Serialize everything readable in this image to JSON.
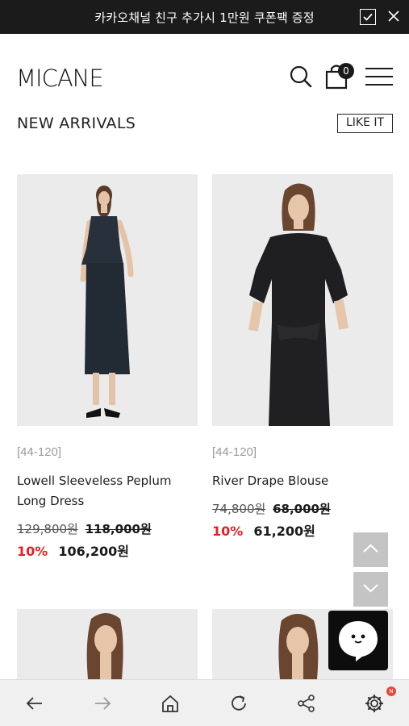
{
  "promo": {
    "text": "카카오채널 친구 추가시 1만원 쿠폰팩 증정"
  },
  "header": {
    "logo_text": "MICANE",
    "cart_count": "0"
  },
  "section": {
    "title": "NEW ARRIVALS",
    "like_button": "LIKE IT"
  },
  "products": [
    {
      "tag": "[44-120]",
      "name": "Lowell Sleeveless Peplum Long Dress",
      "original_price": "129,800원",
      "list_price": "118,000원",
      "discount": "10%",
      "sale_price": "106,200원"
    },
    {
      "tag": "[44-120]",
      "name": "River Drape Blouse",
      "original_price": "74,800원",
      "list_price": "68,000원",
      "discount": "10%",
      "sale_price": "61,200원"
    }
  ],
  "bottom_bar": {
    "notification_badge": "N"
  },
  "colors": {
    "accent_sale": "#e32222",
    "banner_bg": "#1b1b1b",
    "notif": "#e44a3c"
  }
}
